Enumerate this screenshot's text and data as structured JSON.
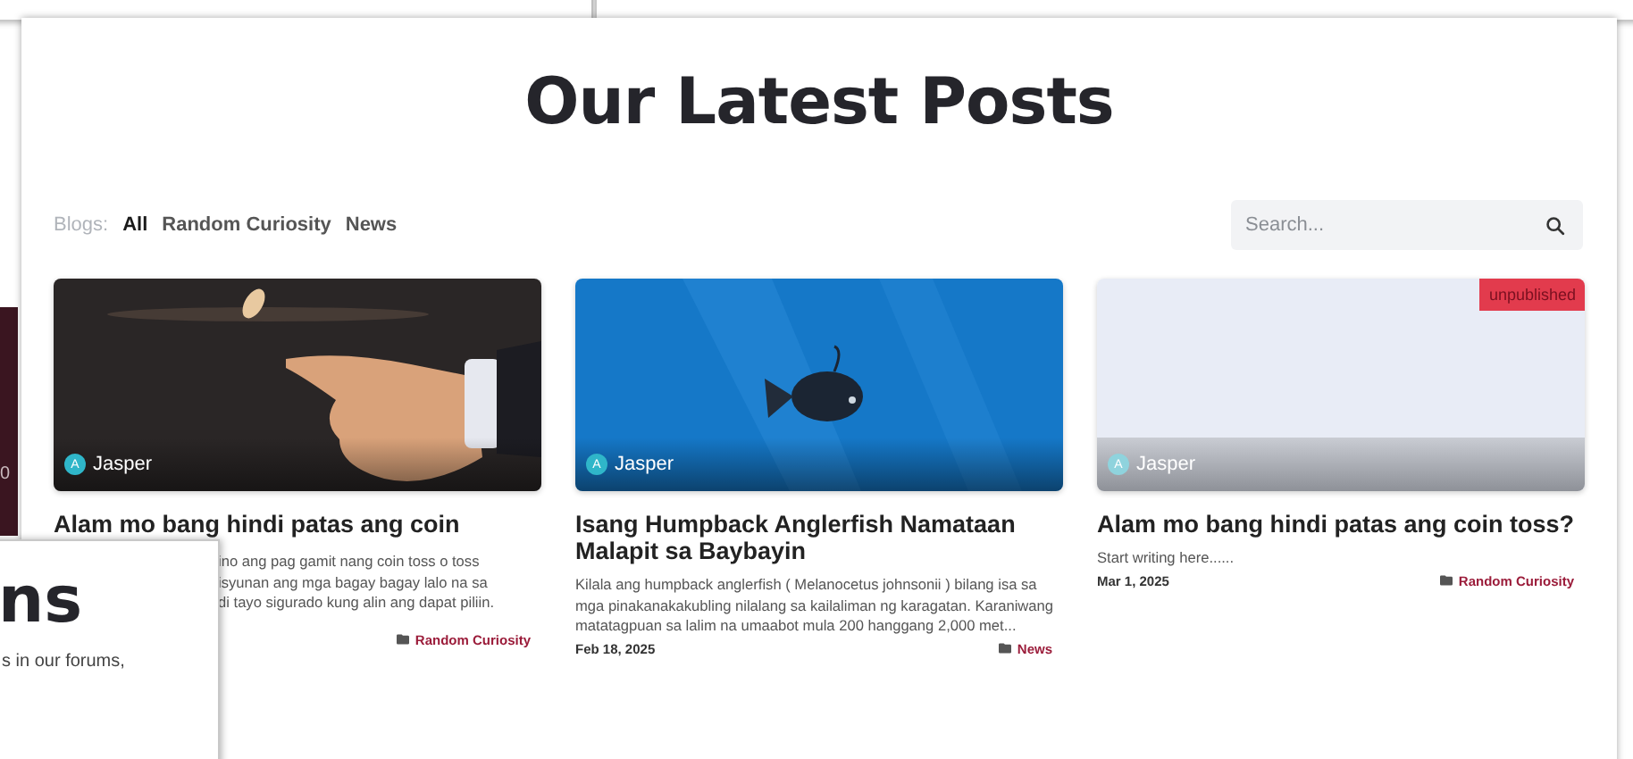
{
  "side_fragment": {
    "text": "0"
  },
  "main": {
    "title": "Our Latest Posts",
    "filters": {
      "label": "Blogs:",
      "items": [
        {
          "label": "All",
          "selected": true
        },
        {
          "label": "Random Curiosity",
          "selected": false
        },
        {
          "label": "News",
          "selected": false
        }
      ]
    },
    "search": {
      "placeholder": "Search..."
    },
    "posts": [
      {
        "image": {
          "kind": "coin"
        },
        "author": {
          "initial": "A",
          "name": "Jasper"
        },
        "title": "Alam mo bang hindi patas ang coin",
        "excerpt_fragments": [
          "ino ang pag gamit nang coin toss o toss",
          "isyunan ang mga bagay bagay lalo na sa",
          "di tayo sigurado kung alin ang dapat piliin."
        ],
        "category": "Random Curiosity"
      },
      {
        "image": {
          "kind": "fish"
        },
        "author": {
          "initial": "A",
          "name": "Jasper"
        },
        "title": "Isang Humpback Anglerfish Namataan Malapit sa Baybayin",
        "excerpt": "Kilala ang humpback anglerfish ( Melanocetus johnsonii ) bilang isa sa mga pinakanakakubling nilalang sa kailaliman ng karagatan. Karaniwang matatagpuan sa lalim na umaabot mula 200 hanggang 2,000 met...",
        "date": "Feb 18, 2025",
        "category": "News"
      },
      {
        "image": {
          "kind": "placeholder"
        },
        "badge": "unpublished",
        "author": {
          "initial": "A",
          "name": "Jasper"
        },
        "title": "Alam mo bang hindi patas ang coin toss?",
        "excerpt": "Start writing here......",
        "date": "Mar 1, 2025",
        "category": "Random Curiosity"
      }
    ]
  },
  "front_panel": {
    "heading": "ns",
    "text": "s in our forums,"
  }
}
